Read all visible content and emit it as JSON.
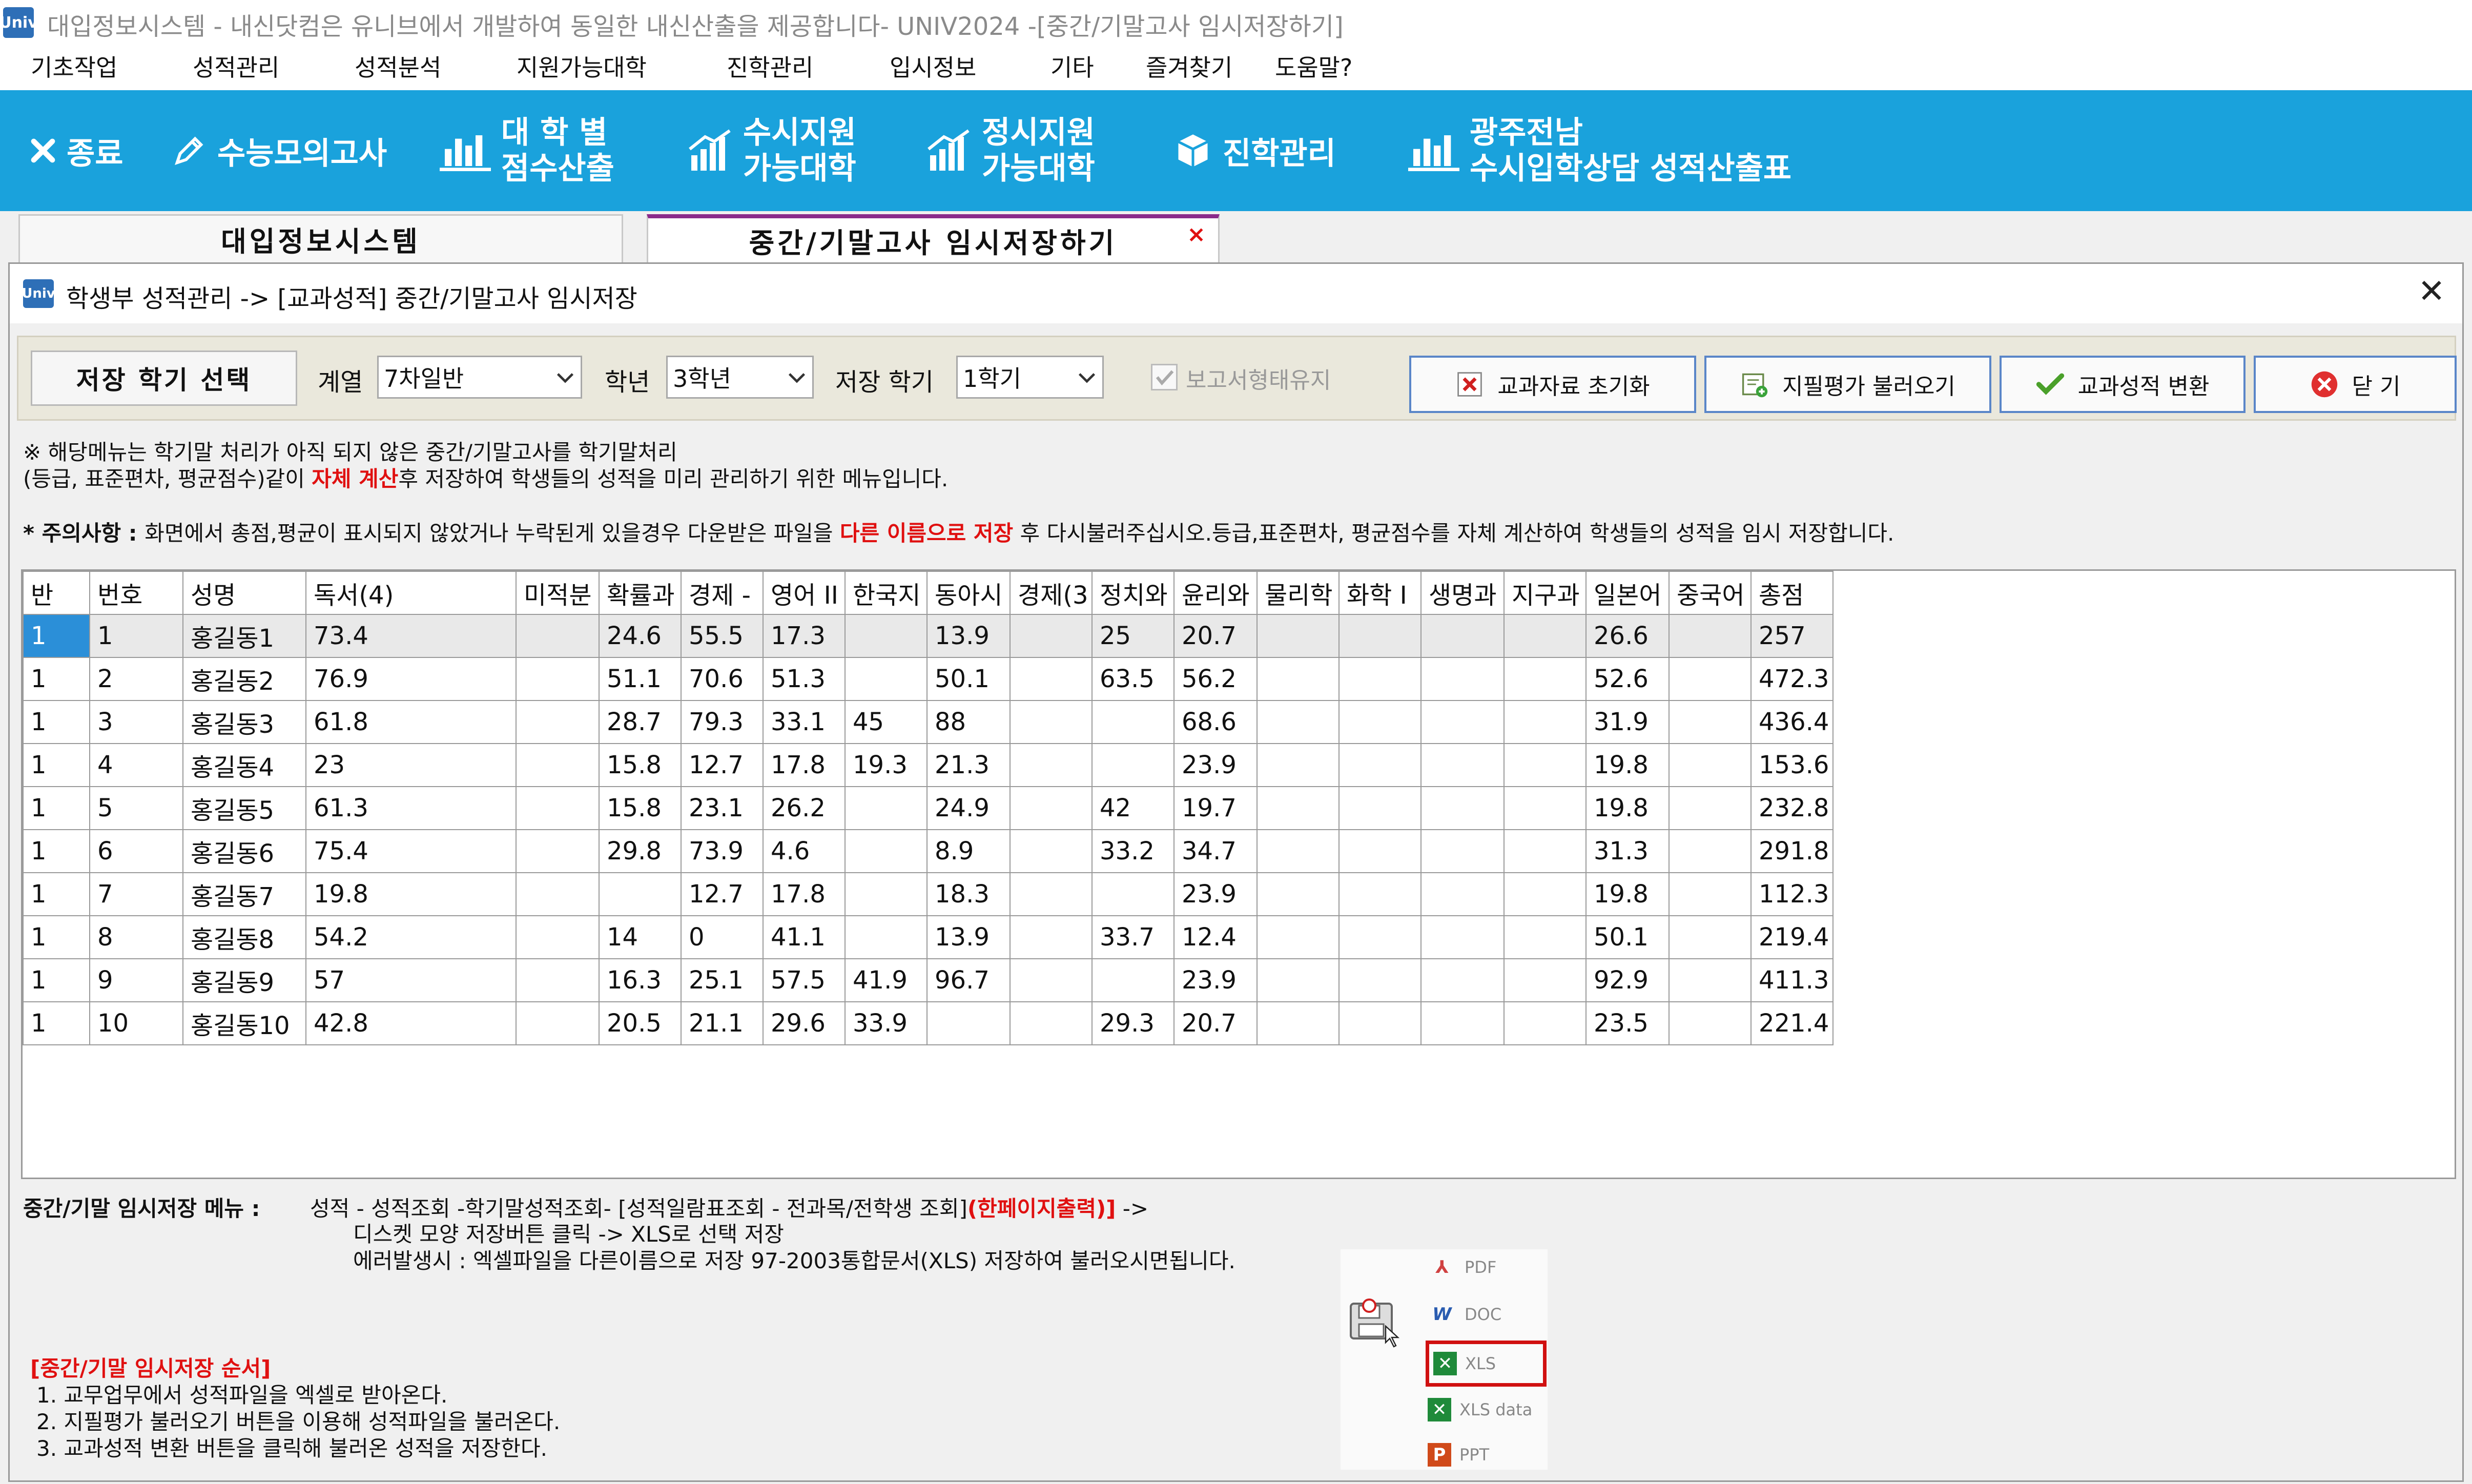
{
  "window": {
    "title": "대입정보시스템 - 내신닷컴은 유니브에서 개발하여 동일한 내신산출을 제공합니다- UNIV2024 -[중간/기말고사 임시저장하기]",
    "app_icon": "Univ"
  },
  "menu": [
    "기초작업",
    "성적관리",
    "성적분석",
    "지원가능대학",
    "진학관리",
    "입시정보",
    "기타",
    "즐겨찾기",
    "도움말?"
  ],
  "toolbar": {
    "exit": "종료",
    "suneung": "수능모의고사",
    "univ_score_1": "대 학 별",
    "univ_score_2": "점수산출",
    "susi_1": "수시지원",
    "susi_2": "가능대학",
    "jeongsi_1": "정시지원",
    "jeongsi_2": "가능대학",
    "jinhak": "진학관리",
    "gwangju_1": "광주전남",
    "gwangju_2": "수시입학상담 성적산출표"
  },
  "tabs": {
    "tab1": "대입정보시스템",
    "tab2": "중간/기말고사 임시저장하기",
    "tab2_close": "×"
  },
  "dialog": {
    "icon": "Univ",
    "title": "학생부 성적관리 -> [교과성적] 중간/기말고사 임시저장",
    "close": "✕"
  },
  "controls": {
    "semester_select_label": "저장 학기 선택",
    "track_label": "계열",
    "track_value": "7차일반",
    "grade_label": "학년",
    "grade_value": "3학년",
    "semester_label": "저장 학기",
    "semester_value": "1학기",
    "keep_format_label": "보고서형태유지",
    "reset_button": "교과자료 초기화",
    "load_button": "지필평가 불러오기",
    "convert_button": "교과성적 변환",
    "close_button": "닫 기"
  },
  "notice": {
    "line1": "※ 해당메뉴는 학기말 처리가 아직 되지 않은 중간/기말고사를 학기말처리",
    "line2a": "(등급, 표준편차, 평균점수)같이 ",
    "line2_red": "자체 계산",
    "line2b": "후 저장하여  학생들의 성적을 미리 관리하기 위한 메뉴입니다.",
    "warn_a": "* 주의사항 : ",
    "warn_b": "화면에서 총점,평균이 표시되지 않았거나 누락된게 있을경우 다운받은 파일을 ",
    "warn_red": "다른 이름으로 저장",
    "warn_c": " 후 다시불러주십시오.등급,표준편차, 평균점수를 자체 계산하여 학생들의 성적을 임시 저장합니다."
  },
  "table": {
    "columns": [
      "반",
      "번호",
      "성명",
      "독서(4)",
      "미적분",
      "확률과",
      "경제 -",
      "영어 II",
      "한국지",
      "동아시",
      "경제(3",
      "정치와",
      "윤리와",
      "물리학",
      "화학 I",
      "생명과",
      "지구과",
      "일본어",
      "중국어",
      "총점"
    ],
    "rows": [
      [
        "1",
        "1",
        "홍길동1",
        "73.4",
        "",
        "24.6",
        "55.5",
        "17.3",
        "",
        "13.9",
        "",
        "25",
        "20.7",
        "",
        "",
        "",
        "",
        "26.6",
        "",
        "257"
      ],
      [
        "1",
        "2",
        "홍길동2",
        "76.9",
        "",
        "51.1",
        "70.6",
        "51.3",
        "",
        "50.1",
        "",
        "63.5",
        "56.2",
        "",
        "",
        "",
        "",
        "52.6",
        "",
        "472.3"
      ],
      [
        "1",
        "3",
        "홍길동3",
        "61.8",
        "",
        "28.7",
        "79.3",
        "33.1",
        "45",
        "88",
        "",
        "",
        "68.6",
        "",
        "",
        "",
        "",
        "31.9",
        "",
        "436.4"
      ],
      [
        "1",
        "4",
        "홍길동4",
        "23",
        "",
        "15.8",
        "12.7",
        "17.8",
        "19.3",
        "21.3",
        "",
        "",
        "23.9",
        "",
        "",
        "",
        "",
        "19.8",
        "",
        "153.6"
      ],
      [
        "1",
        "5",
        "홍길동5",
        "61.3",
        "",
        "15.8",
        "23.1",
        "26.2",
        "",
        "24.9",
        "",
        "42",
        "19.7",
        "",
        "",
        "",
        "",
        "19.8",
        "",
        "232.8"
      ],
      [
        "1",
        "6",
        "홍길동6",
        "75.4",
        "",
        "29.8",
        "73.9",
        "4.6",
        "",
        "8.9",
        "",
        "33.2",
        "34.7",
        "",
        "",
        "",
        "",
        "31.3",
        "",
        "291.8"
      ],
      [
        "1",
        "7",
        "홍길동7",
        "19.8",
        "",
        "",
        "12.7",
        "17.8",
        "",
        "18.3",
        "",
        "",
        "23.9",
        "",
        "",
        "",
        "",
        "19.8",
        "",
        "112.3"
      ],
      [
        "1",
        "8",
        "홍길동8",
        "54.2",
        "",
        "14",
        "0",
        "41.1",
        "",
        "13.9",
        "",
        "33.7",
        "12.4",
        "",
        "",
        "",
        "",
        "50.1",
        "",
        "219.4"
      ],
      [
        "1",
        "9",
        "홍길동9",
        "57",
        "",
        "16.3",
        "25.1",
        "57.5",
        "41.9",
        "96.7",
        "",
        "",
        "23.9",
        "",
        "",
        "",
        "",
        "92.9",
        "",
        "411.3"
      ],
      [
        "1",
        "10",
        "홍길동10",
        "42.8",
        "",
        "20.5",
        "21.1",
        "29.6",
        "33.9",
        "",
        "",
        "29.3",
        "20.7",
        "",
        "",
        "",
        "",
        "23.5",
        "",
        "221.4"
      ]
    ]
  },
  "bottom": {
    "menu_label": "중간/기말 임시저장 메뉴 :",
    "path_a": "성적 - 성적조회 -학기말성적조회- [성적일람표조회 - 전과목/전학생 조회]",
    "path_red": "(한페이지출력)]",
    "path_b": " ->",
    "line2": "디스켓 모양 저장버튼 클릭 -> XLS로 선택 저장",
    "line3": "에러발생시 : 엑셀파일을 다른이름으로 저장 97-2003통합문서(XLS) 저장하여 불러오시면됩니다.",
    "steps_title": "[중간/기말 임시저장 순서]",
    "step1": "1. 교무업무에서 성적파일을 엑셀로 받아온다.",
    "step2": "2. 지필평가 불러오기 버튼을 이용해 성적파일을 불러온다.",
    "step3": "3. 교과성적 변환 버튼을 클릭해 불러온 성적을 저장한다."
  },
  "export_menu": {
    "pdf": "PDF",
    "doc": "DOC",
    "xls": "XLS",
    "xls_data": "XLS data",
    "ppt": "PPT",
    "pdf_glyph": "⅄",
    "doc_glyph": "W",
    "xls_glyph": "✕",
    "xlsdata_glyph": "✕",
    "ppt_glyph": "P"
  },
  "colors": {
    "toolbar": "#1aa2dc",
    "active_tab": "#8b2a8b",
    "accent_red": "#e01010",
    "focus_cell": "#2b8fd8"
  }
}
